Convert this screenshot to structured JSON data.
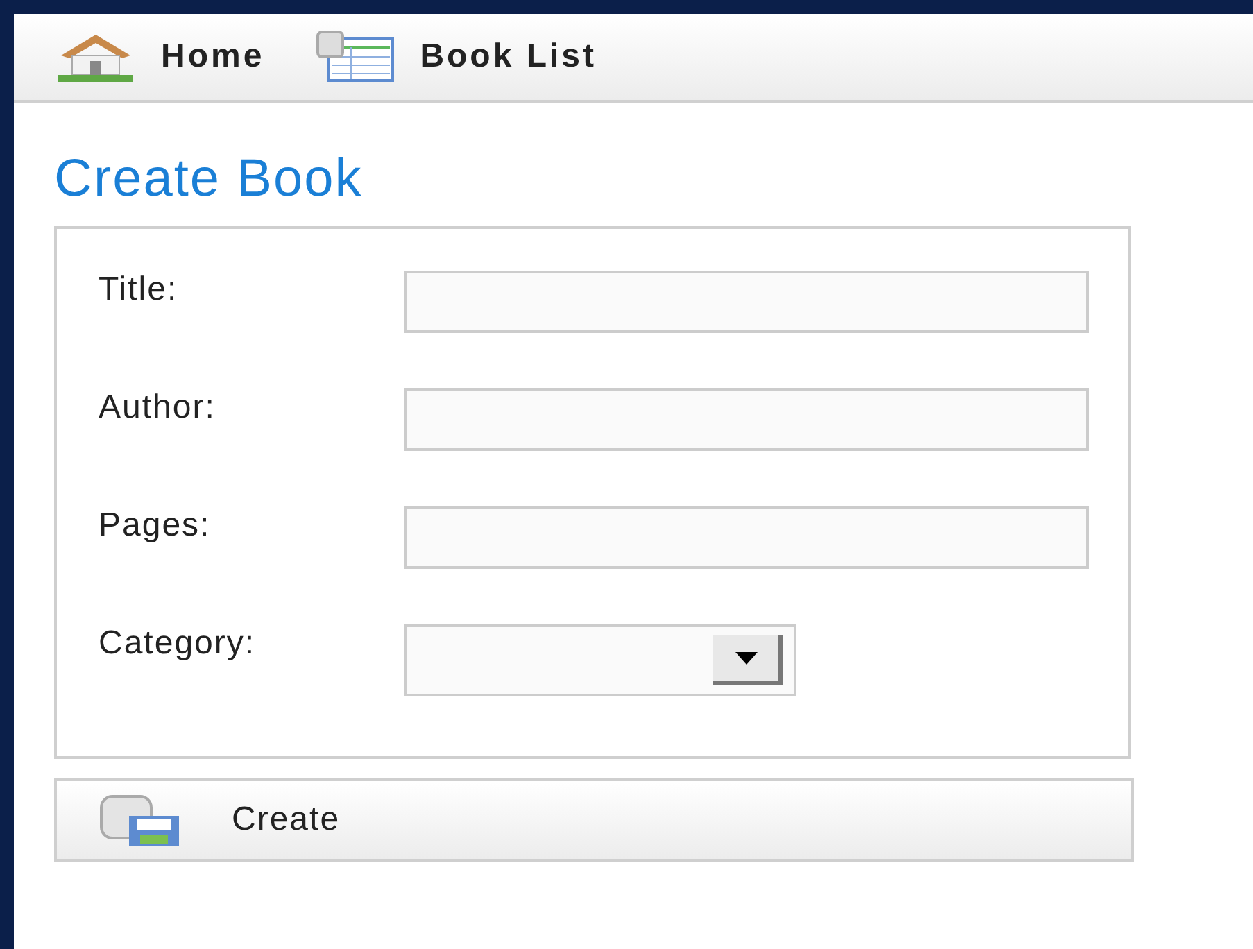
{
  "nav": [
    {
      "label": "Home",
      "kind": "home"
    },
    {
      "label": "Book List",
      "kind": "list"
    }
  ],
  "heading": "Create Book",
  "fields": [
    {
      "label": "Title:",
      "kind": "text"
    },
    {
      "label": "Author:",
      "kind": "text"
    },
    {
      "label": "Pages:",
      "kind": "text"
    },
    {
      "label": "Category:",
      "kind": "select"
    }
  ],
  "submit": {
    "label": "Create"
  }
}
